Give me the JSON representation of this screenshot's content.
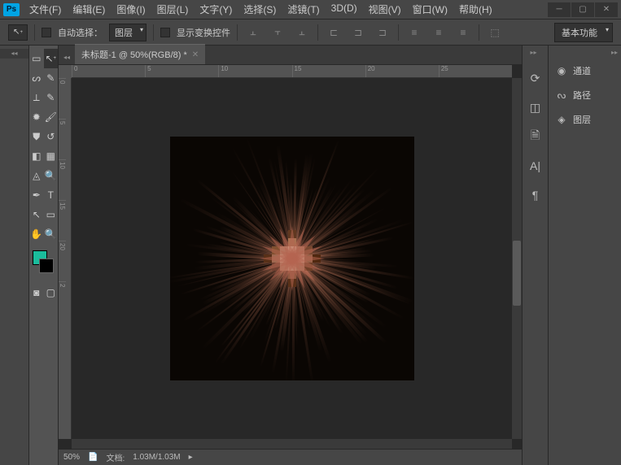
{
  "app": {
    "logo": "Ps"
  },
  "menu": [
    "文件(F)",
    "编辑(E)",
    "图像(I)",
    "图层(L)",
    "文字(Y)",
    "选择(S)",
    "滤镜(T)",
    "3D(D)",
    "视图(V)",
    "窗口(W)",
    "帮助(H)"
  ],
  "options": {
    "auto_select": "自动选择：",
    "target": "图层",
    "show_transform": "显示变换控件",
    "workspace": "基本功能"
  },
  "doc": {
    "tab": "未标题-1 @ 50%(RGB/8) *",
    "zoom": "50%",
    "doc_label": "文档:",
    "doc_size": "1.03M/1.03M"
  },
  "ruler_h": [
    "0",
    "5",
    "10",
    "15",
    "20",
    "25"
  ],
  "ruler_v": [
    "0",
    "5",
    "10",
    "15",
    "20",
    "2"
  ],
  "panels": {
    "channels": "通道",
    "paths": "路径",
    "layers": "图层"
  }
}
